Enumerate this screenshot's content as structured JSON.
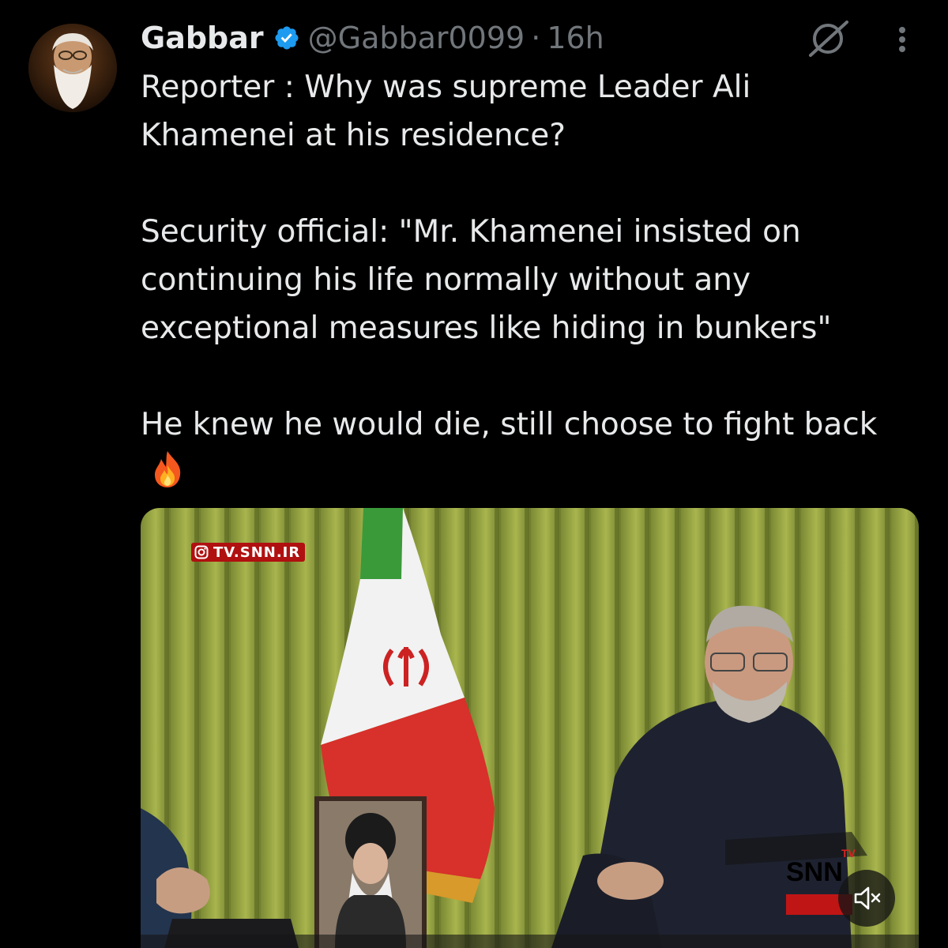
{
  "tweet": {
    "author": {
      "name": "Gabbar",
      "handle": "@Gabbar0099",
      "separator": "·",
      "time": "16h",
      "verified": true
    },
    "text": {
      "p1": "Reporter : Why was supreme Leader Ali Khamenei at his residence?",
      "p2": "Security official: \"Mr. Khamenei insisted on continuing his life normally without any exceptional measures like hiding in bunkers\"",
      "p3": "He knew he would die, still choose to fight back",
      "emoji": "fire-emoji"
    },
    "media": {
      "watermark": "TV.SNN.IR",
      "channel_logo": "SNN",
      "channel_logo_tv": "TV",
      "mute_state": "muted"
    }
  },
  "icons": {
    "verified": "verified-badge-icon",
    "grok": "grok-icon",
    "more": "more-options-icon",
    "mute": "volume-muted-icon",
    "instagram": "instagram-icon"
  },
  "colors": {
    "background": "#000000",
    "text_primary": "#e7e9ea",
    "text_secondary": "#71767b",
    "verified_blue": "#1d9bf0",
    "watermark_red": "#b01010"
  }
}
